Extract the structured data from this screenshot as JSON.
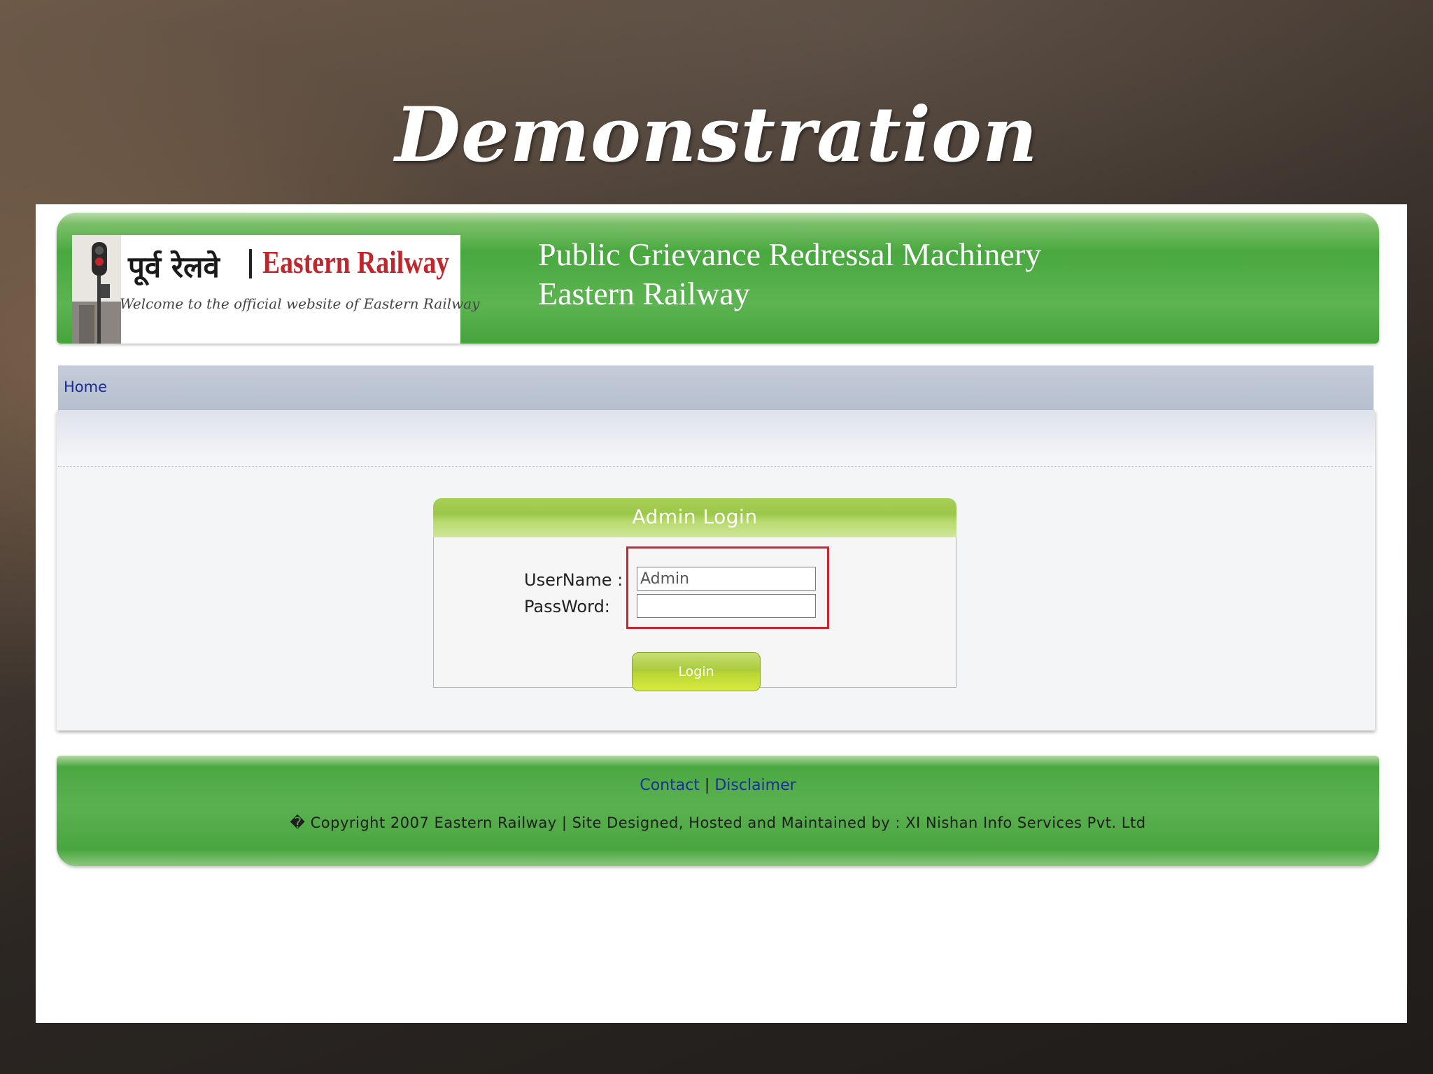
{
  "slide": {
    "title": "Demonstration"
  },
  "header": {
    "logo_hindi": "पूर्व रेलवे",
    "logo_english": "Eastern Railway",
    "logo_tagline": "Welcome to the official website of Eastern Railway",
    "title_line1": "Public Grievance Redressal Machinery",
    "title_line2": "Eastern Railway"
  },
  "nav": {
    "home_label": "Home"
  },
  "login": {
    "title": "Admin Login",
    "username_label": "UserName :",
    "password_label": "PassWord:",
    "username_value": "Admin",
    "password_value": "",
    "button_label": "Login"
  },
  "footer": {
    "contact_label": "Contact",
    "separator": "|",
    "disclaimer_label": "Disclaimer",
    "copyright": "� Copyright 2007 Eastern Railway |  Site Designed, Hosted and Maintained by : XI Nishan Info Services Pvt. Ltd"
  },
  "colors": {
    "header_green": "#49a83f",
    "nav_blue_gray": "#b6bfcf",
    "highlight_red": "#d0222f",
    "brand_red": "#c0262c",
    "link_blue": "#1a2a9a"
  }
}
